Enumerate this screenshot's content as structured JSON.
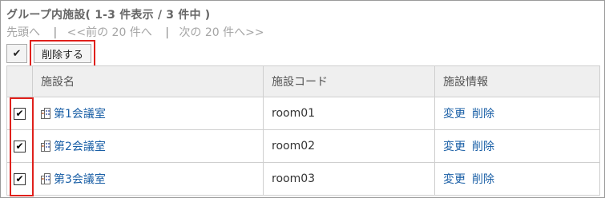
{
  "header": {
    "title": "グループ内施設( 1-3 件表示 / 3 件中 )"
  },
  "pager": {
    "first": "先頭へ",
    "prev": "<<前の 20 件へ",
    "next": "次の 20 件へ>>",
    "separator": "|"
  },
  "toolbar": {
    "check_glyph": "✔",
    "delete_label": "削除する"
  },
  "table": {
    "columns": [
      "施設名",
      "施設コード",
      "施設情報"
    ],
    "rows": [
      {
        "name": "第1会議室",
        "code": "room01",
        "edit": "変更",
        "delete": "削除",
        "checked": true
      },
      {
        "name": "第2会議室",
        "code": "room02",
        "edit": "変更",
        "delete": "削除",
        "checked": true
      },
      {
        "name": "第3会議室",
        "code": "room03",
        "edit": "変更",
        "delete": "削除",
        "checked": true
      }
    ]
  },
  "colors": {
    "highlight": "#e0201b",
    "link": "#1a5fa6"
  },
  "icons": {
    "row_icon": "facility-icon",
    "check": "check-icon"
  }
}
